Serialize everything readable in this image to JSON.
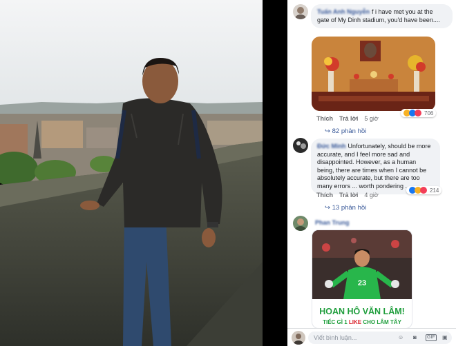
{
  "comments": [
    {
      "author": "Tuấn Anh Nguyễn",
      "text": "f i have met you at the gate of My Dinh stadium, you'd have been....",
      "like_label": "Thích",
      "reply_label": "Trả lời",
      "time": "5 giờ",
      "reaction_count": "706",
      "replies_label": "82 phản hồi"
    },
    {
      "author": "Đức Minh",
      "text": "Unfortunately, should be more accurate, and I feel more sad and disappointed. However, as a human being, there are times when I cannot be absolutely accurate, but there are too many errors ... worth pondering ...",
      "like_label": "Thích",
      "reply_label": "Trả lời",
      "time": "4 giờ",
      "reaction_count": "214",
      "replies_label": "13 phản hồi"
    },
    {
      "author": "Phan Trung",
      "meme_headline": "HOAN HÔ VĂN LÂM!",
      "meme_sub_a": "TIẾC GÌ 1 ",
      "meme_sub_b": "LIKE",
      "meme_sub_c": " CHO LÂM TÂY",
      "jersey_number": "23"
    }
  ],
  "composer": {
    "placeholder": "Viết bình luận...",
    "gif_label": "GIF"
  },
  "colors": {
    "link": "#385898",
    "bubble": "#f0f2f5",
    "meme_green": "#1f9e3c",
    "meme_red": "#d9232d",
    "like_blue": "#1877f2",
    "love_red": "#f33e58",
    "haha_yellow": "#f7b125"
  },
  "icons": [
    "avatar-icon",
    "like-reaction-icon",
    "love-reaction-icon",
    "haha-reaction-icon",
    "reply-arrow-icon",
    "emoji-icon",
    "camera-icon",
    "gif-icon",
    "sticker-icon"
  ]
}
